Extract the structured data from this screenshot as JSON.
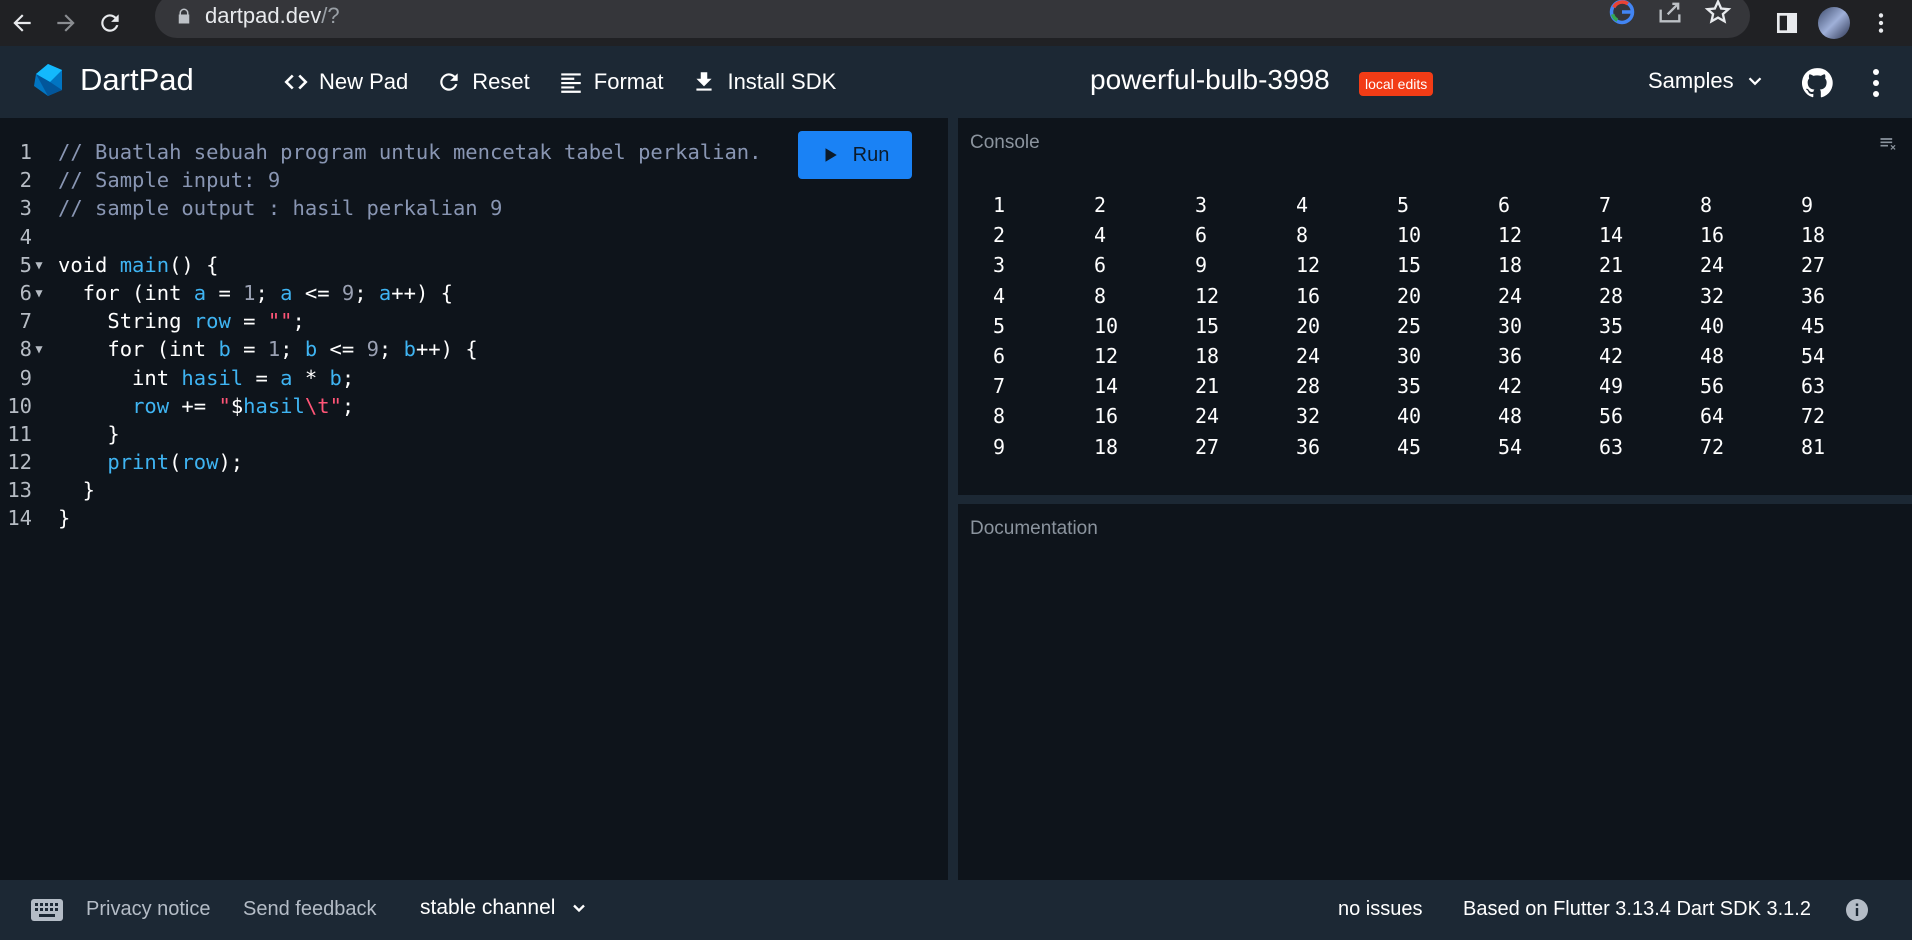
{
  "browser": {
    "url_host": "dartpad.dev",
    "url_path": "/?"
  },
  "header": {
    "app_name": "DartPad",
    "toolbar": {
      "new_pad": "New Pad",
      "reset": "Reset",
      "format": "Format",
      "install_sdk": "Install SDK"
    },
    "pad_name": "powerful-bulb-3998",
    "local_edits_badge": "local edits",
    "samples": "Samples"
  },
  "editor": {
    "run_label": "Run",
    "line_numbers": [
      "1",
      "2",
      "3",
      "4",
      "5",
      "6",
      "7",
      "8",
      "9",
      "10",
      "11",
      "12",
      "13",
      "14"
    ],
    "lines": [
      "// Buatlah sebuah program untuk mencetak tabel perkalian.",
      "// Sample input: 9",
      "// sample output : hasil perkalian 9",
      "",
      "void main() {",
      "  for (int a = 1; a <= 9; a++) {",
      "    String row = \"\";",
      "    for (int b = 1; b <= 9; b++) {",
      "      int hasil = a * b;",
      "      row += \"$hasil\\t\";",
      "    }",
      "    print(row);",
      "  }",
      "}"
    ]
  },
  "console": {
    "title": "Console",
    "rows": [
      [
        "1",
        "2",
        "3",
        "4",
        "5",
        "6",
        "7",
        "8",
        "9"
      ],
      [
        "2",
        "4",
        "6",
        "8",
        "10",
        "12",
        "14",
        "16",
        "18"
      ],
      [
        "3",
        "6",
        "9",
        "12",
        "15",
        "18",
        "21",
        "24",
        "27"
      ],
      [
        "4",
        "8",
        "12",
        "16",
        "20",
        "24",
        "28",
        "32",
        "36"
      ],
      [
        "5",
        "10",
        "15",
        "20",
        "25",
        "30",
        "35",
        "40",
        "45"
      ],
      [
        "6",
        "12",
        "18",
        "24",
        "30",
        "36",
        "42",
        "48",
        "54"
      ],
      [
        "7",
        "14",
        "21",
        "28",
        "35",
        "42",
        "49",
        "56",
        "63"
      ],
      [
        "8",
        "16",
        "24",
        "32",
        "40",
        "48",
        "56",
        "64",
        "72"
      ],
      [
        "9",
        "18",
        "27",
        "36",
        "45",
        "54",
        "63",
        "72",
        "81"
      ]
    ]
  },
  "documentation": {
    "title": "Documentation"
  },
  "footer": {
    "privacy": "Privacy notice",
    "feedback": "Send feedback",
    "channel": "stable channel",
    "issues": "no issues",
    "version": "Based on Flutter 3.13.4 Dart SDK 3.1.2"
  },
  "colors": {
    "accent": "#1a82f5",
    "badge": "#f23c16",
    "header_bg": "#1c2834",
    "editor_bg": "#0e141b"
  }
}
